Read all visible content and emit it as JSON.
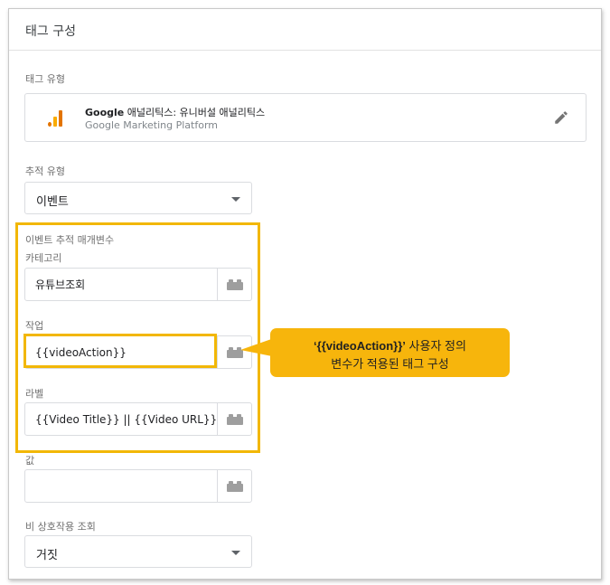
{
  "panel": {
    "title": "태그 구성"
  },
  "tag_type": {
    "label": "태그 유형",
    "name_bold": "Google",
    "name_rest": " 애널리틱스: 유니버설 애널리틱스",
    "platform": "Google Marketing Platform",
    "icon": "google-analytics-icon",
    "edit_icon": "pencil-icon"
  },
  "track_type": {
    "label": "추적 유형",
    "value": "이벤트"
  },
  "event_params": {
    "section_label": "이벤트 추적 매개변수",
    "category": {
      "label": "카테고리",
      "value": "유튜브조회"
    },
    "action": {
      "label": "작업",
      "value": "{{videoAction}}"
    },
    "label": {
      "label": "라벨",
      "value": "{{Video Title}} || {{Video URL}}"
    },
    "value": {
      "label": "값",
      "value": ""
    }
  },
  "non_interaction": {
    "label": "비 상호작용 조회",
    "value": "거짓"
  },
  "callout": {
    "line1_bold": "‘{{videoAction}}’",
    "line1_rest": " 사용자 정의",
    "line2": "변수가 적용된 태그 구성"
  },
  "colors": {
    "highlight": "#f2b705",
    "callout_bg": "#f7b50c",
    "ga_orange": "#e37400",
    "ga_yellow": "#f9ab00"
  }
}
